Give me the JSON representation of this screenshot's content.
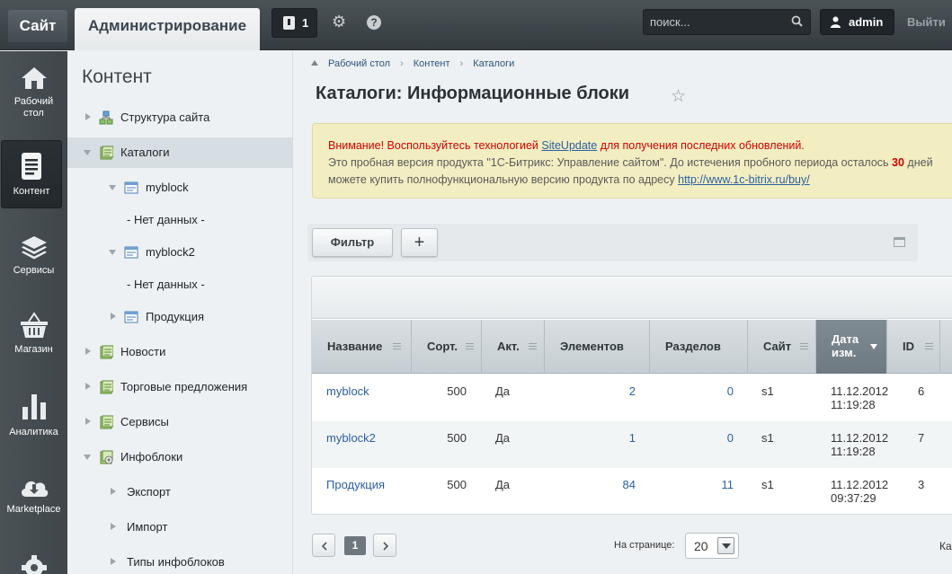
{
  "topbar": {
    "site_tab": "Сайт",
    "admin_tab": "Администрирование",
    "notifications_count": "1",
    "search_placeholder": "поиск...",
    "username": "admin",
    "logout": "Выйти"
  },
  "iconmenu": [
    {
      "label_line1": "Рабочий",
      "label_line2": "стол",
      "icon": "home-icon"
    },
    {
      "label_line1": "Контент",
      "label_line2": "",
      "icon": "content-icon",
      "active": true
    },
    {
      "label_line1": "Сервисы",
      "label_line2": "",
      "icon": "layers-icon"
    },
    {
      "label_line1": "Магазин",
      "label_line2": "",
      "icon": "basket-icon"
    },
    {
      "label_line1": "Аналитика",
      "label_line2": "",
      "icon": "analytics-icon"
    },
    {
      "label_line1": "Marketplace",
      "label_line2": "",
      "icon": "cloud-download-icon"
    },
    {
      "icon": "gear-icon"
    }
  ],
  "sidemenu": {
    "title": "Контент",
    "items": [
      {
        "label": "Структура сайта"
      },
      {
        "label": "Каталоги"
      },
      {
        "label": "myblock"
      },
      {
        "label": "- Нет данных -"
      },
      {
        "label": "myblock2"
      },
      {
        "label": "- Нет данных -"
      },
      {
        "label": "Продукция"
      },
      {
        "label": "Новости"
      },
      {
        "label": "Торговые предложения"
      },
      {
        "label": "Сервисы"
      },
      {
        "label": "Инфоблоки"
      },
      {
        "label": "Экспорт"
      },
      {
        "label": "Импорт"
      },
      {
        "label": "Типы инфоблоков"
      }
    ]
  },
  "breadcrumb": [
    "Рабочий стол",
    "Контент",
    "Каталоги"
  ],
  "page_title": "Каталоги: Информационные блоки",
  "alert": {
    "warn_prefix": "Внимание! Воспользуйтесь технологией ",
    "warn_link": "SiteUpdate",
    "warn_suffix": " для получения последних обновлений.",
    "line2_prefix": "Это пробная версия продукта \"1С-Битрикс: Управление сайтом\". До истечения пробного периода осталось ",
    "days": "30",
    "line2_suffix": " дней",
    "line3_prefix": "можете купить полнофункциональную версию продукта по адресу ",
    "line3_link": "http://www.1c-bitrix.ru/buy/"
  },
  "filter": {
    "filter_label": "Фильтр",
    "add_label": "+"
  },
  "table": {
    "columns": [
      "Название",
      "Сорт.",
      "Акт.",
      "Элементов",
      "Разделов",
      "Сайт",
      "Дата изм.",
      "ID"
    ],
    "sorted_column_line1": "Дата",
    "sorted_column_line2": "изм.",
    "rows": [
      {
        "name": "myblock",
        "sort": "500",
        "active": "Да",
        "elements": "2",
        "sections": "0",
        "site": "s1",
        "date": "11.12.2012",
        "time": "11:19:28",
        "id": "6"
      },
      {
        "name": "myblock2",
        "sort": "500",
        "active": "Да",
        "elements": "1",
        "sections": "0",
        "site": "s1",
        "date": "11.12.2012",
        "time": "11:19:28",
        "id": "7"
      },
      {
        "name": "Продукция",
        "sort": "500",
        "active": "Да",
        "elements": "84",
        "sections": "11",
        "site": "s1",
        "date": "11.12.2012",
        "time": "09:37:29",
        "id": "3"
      }
    ]
  },
  "pager": {
    "current_page": "1",
    "per_page_label": "На странице:",
    "per_page_value": "20",
    "truncated_text": "Ка"
  }
}
